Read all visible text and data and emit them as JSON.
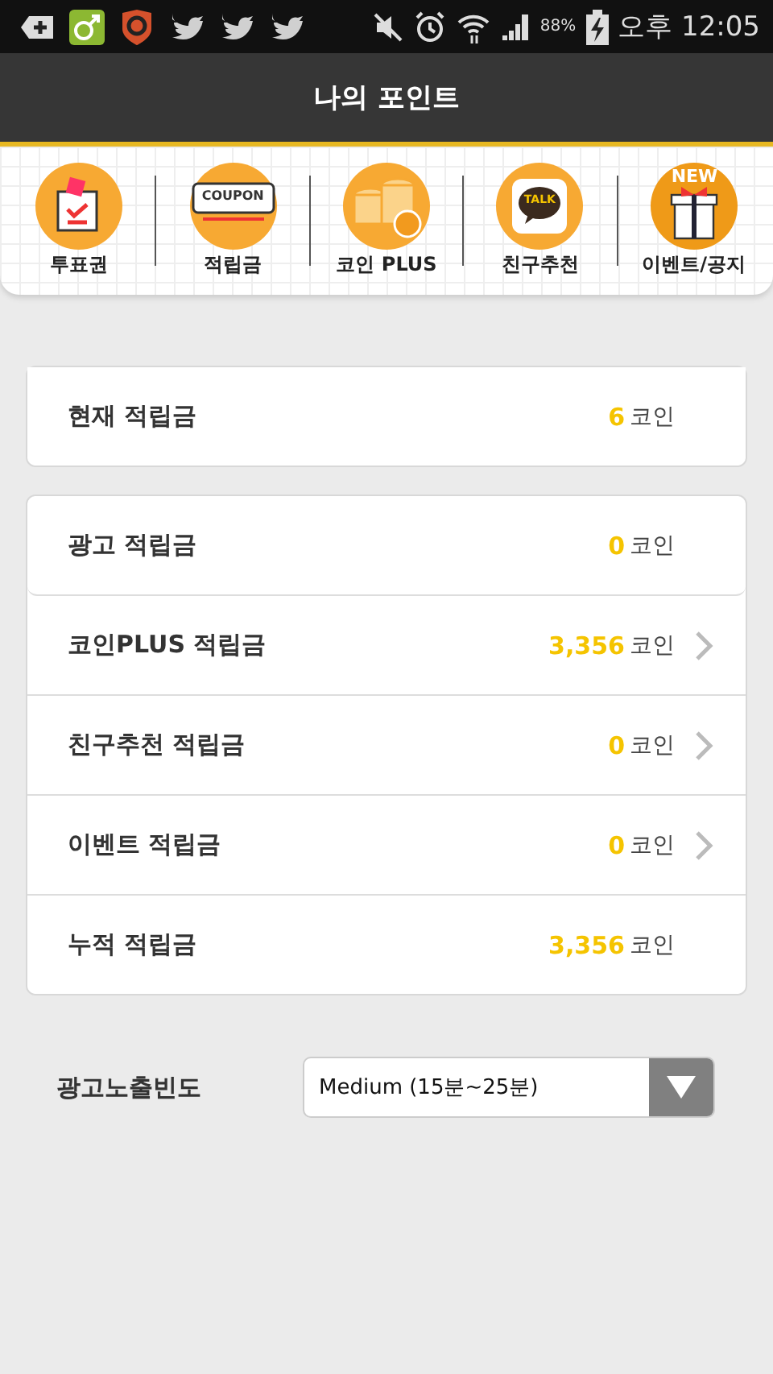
{
  "status_bar": {
    "battery": "88%",
    "time": "오후 12:05"
  },
  "title": "나의 포인트",
  "shortcuts": [
    {
      "kind": "ballot",
      "label": "투표권"
    },
    {
      "kind": "coupon",
      "label": "적립금",
      "badge": "COUPON"
    },
    {
      "kind": "coins",
      "label": "코인 PLUS"
    },
    {
      "kind": "talk",
      "label": "친구추천",
      "badge": "TALK"
    },
    {
      "kind": "gift",
      "label": "이벤트/공지",
      "badge": "NEW"
    }
  ],
  "current": {
    "label": "현재 적립금",
    "value": "6",
    "unit": "코인"
  },
  "rows": [
    {
      "label": "광고 적립금",
      "value": "0",
      "unit": "코인",
      "arrow": false
    },
    {
      "label": "코인PLUS 적립금",
      "value": "3,356",
      "unit": "코인",
      "arrow": true
    },
    {
      "label": "친구추천 적립금",
      "value": "0",
      "unit": "코인",
      "arrow": true
    },
    {
      "label": "이벤트 적립금",
      "value": "0",
      "unit": "코인",
      "arrow": true
    },
    {
      "label": "누적 적립금",
      "value": "3,356",
      "unit": "코인",
      "arrow": false
    }
  ],
  "frequency": {
    "label": "광고노출빈도",
    "value": "Medium (15분~25분)"
  }
}
